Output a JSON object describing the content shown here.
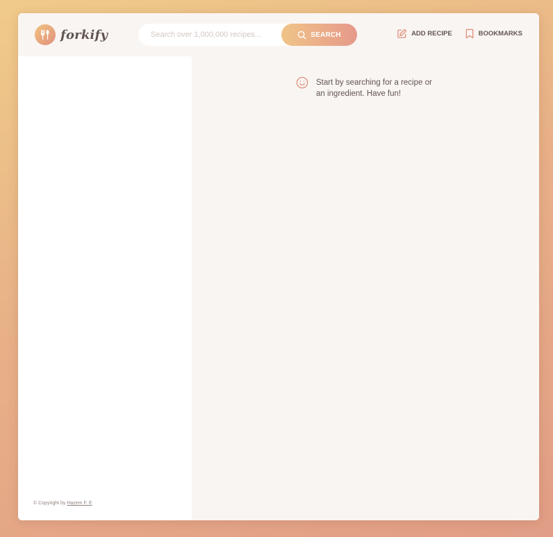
{
  "app": {
    "name": "forkify"
  },
  "search": {
    "placeholder": "Search over 1,000,000 recipes...",
    "value": "",
    "button_label": "SEARCH"
  },
  "nav": {
    "add_recipe_label": "ADD RECIPE",
    "bookmarks_label": "BOOKMARKS"
  },
  "main": {
    "message": "Start by searching for a recipe or an ingredient. Have fun!"
  },
  "footer": {
    "copyright_prefix": "© Copyright by ",
    "author": "Hazem F. E"
  },
  "colors": {
    "accent_start": "#f0c488",
    "accent_end": "#e6998a",
    "text": "#615551",
    "icon": "#e1917d"
  },
  "icons": {
    "logo": "fork-knife-icon",
    "search": "search-icon",
    "add_recipe": "edit-icon",
    "bookmarks": "bookmark-icon",
    "message": "smile-icon"
  }
}
